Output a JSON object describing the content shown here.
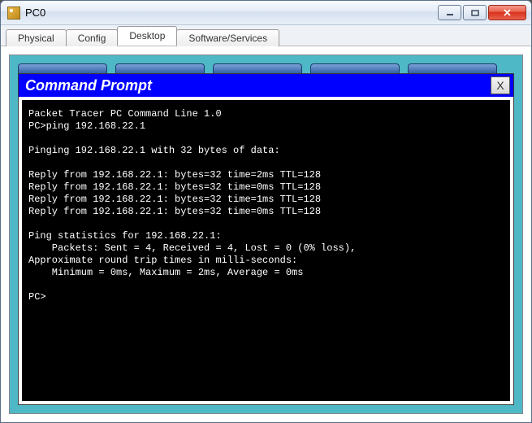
{
  "window": {
    "title": "PC0"
  },
  "tabs": {
    "physical": "Physical",
    "config": "Config",
    "desktop": "Desktop",
    "software": "Software/Services",
    "active": "desktop"
  },
  "cmd": {
    "title": "Command Prompt",
    "close_label": "X"
  },
  "terminal": {
    "lines": [
      "Packet Tracer PC Command Line 1.0",
      "PC>ping 192.168.22.1",
      "",
      "Pinging 192.168.22.1 with 32 bytes of data:",
      "",
      "Reply from 192.168.22.1: bytes=32 time=2ms TTL=128",
      "Reply from 192.168.22.1: bytes=32 time=0ms TTL=128",
      "Reply from 192.168.22.1: bytes=32 time=1ms TTL=128",
      "Reply from 192.168.22.1: bytes=32 time=0ms TTL=128",
      "",
      "Ping statistics for 192.168.22.1:",
      "    Packets: Sent = 4, Received = 4, Lost = 0 (0% loss),",
      "Approximate round trip times in milli-seconds:",
      "    Minimum = 0ms, Maximum = 2ms, Average = 0ms",
      "",
      "PC>"
    ]
  }
}
